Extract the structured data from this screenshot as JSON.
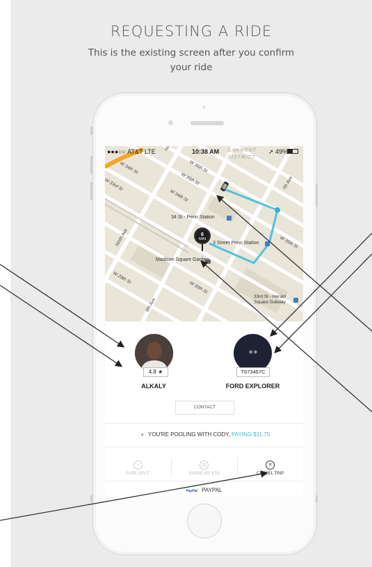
{
  "header": {
    "title": "REQUESTING A RIDE",
    "subtitle": "This is the existing screen after you confirm your ride"
  },
  "status_bar": {
    "carrier": "●●●○○ AT&T  LTE",
    "time": "10:38 AM",
    "battery": "➚ 49%"
  },
  "map": {
    "labels": {
      "garment": "GARMENT DISTRICT",
      "w36": "W 36th St",
      "w35": "W 35th St",
      "w34a": "W 34th St",
      "w34b": "W 34th St",
      "w33": "W 33rd St",
      "w30": "W 30th St",
      "w29": "W 29th St",
      "ninth": "Ninth Ave",
      "eighth": "8th Ave",
      "seventh": "7th Ave",
      "w35e": "W 35th St",
      "station1": "34 St - Penn Station",
      "station2": "3 Street Penn Station",
      "msg": "Madison Square Garden",
      "herald": "33rd St - Herald Square Subway",
      "nint": "Nint"
    },
    "eta": {
      "value": "6",
      "unit": "MIN"
    }
  },
  "driver": {
    "name": "ALKALY",
    "rating": "4.8 ★"
  },
  "vehicle": {
    "plate": "T673467C",
    "model": "FORD EXPLORER"
  },
  "contact_label": "CONTACT",
  "pool": {
    "text": "YOU'RE POOLING WITH CODY,",
    "paying": "PAYING $11.75"
  },
  "actions": [
    {
      "label": "FARE SPLIT",
      "icon": "◔"
    },
    {
      "label": "SHARE MY ETA",
      "icon": "◷"
    },
    {
      "label": "CANCEL TRIP",
      "icon": "✕"
    }
  ],
  "payment": {
    "brand": "PayPal",
    "label": "PAYPAL"
  },
  "colors": {
    "route": "#4fc3dc",
    "accent": "#3bb8c8",
    "map_bg": "#e8e4d8",
    "vehicle_circle": "#1f2233"
  }
}
